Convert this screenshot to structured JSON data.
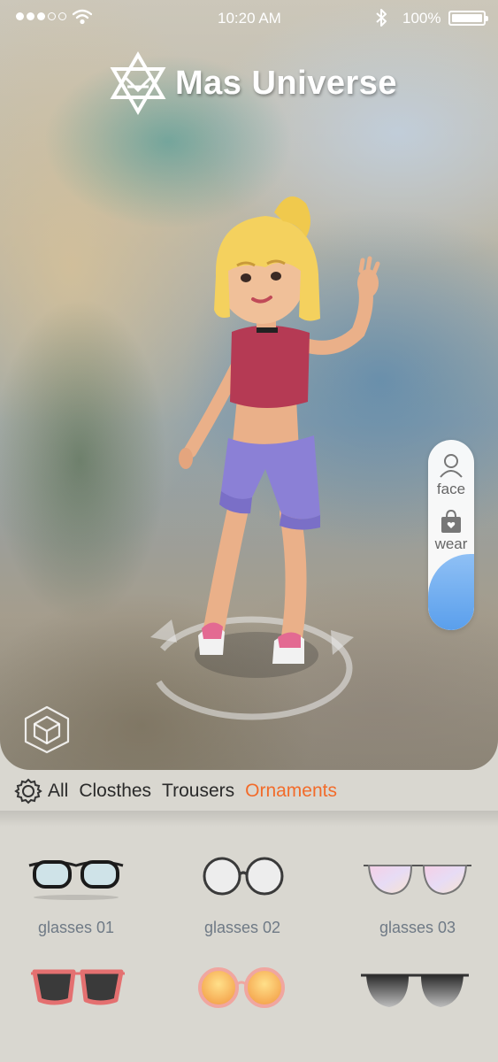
{
  "status_bar": {
    "time": "10:20 AM",
    "battery": "100%",
    "signal_bars_filled": 3,
    "signal_bars_total": 5
  },
  "app": {
    "title": "Mas Universe"
  },
  "side_panel": {
    "face_label": "face",
    "wear_label": "wear",
    "level_fraction": 0.4
  },
  "categories": {
    "items": [
      "All",
      "Closthes",
      "Trousers",
      "Ornaments"
    ],
    "active": "Ornaments"
  },
  "items": [
    {
      "label": "glasses 01",
      "style": "clear-black"
    },
    {
      "label": "glasses 02",
      "style": "round-wire"
    },
    {
      "label": "glasses 03",
      "style": "aviator-iridescent"
    },
    {
      "label": "",
      "style": "red-sunglasses"
    },
    {
      "label": "",
      "style": "orange-round"
    },
    {
      "label": "",
      "style": "aviator-dark"
    }
  ],
  "colors": {
    "accent": "#f26b2a",
    "slider_fill": "#5a9fec",
    "label_gray": "#6f7a86"
  }
}
